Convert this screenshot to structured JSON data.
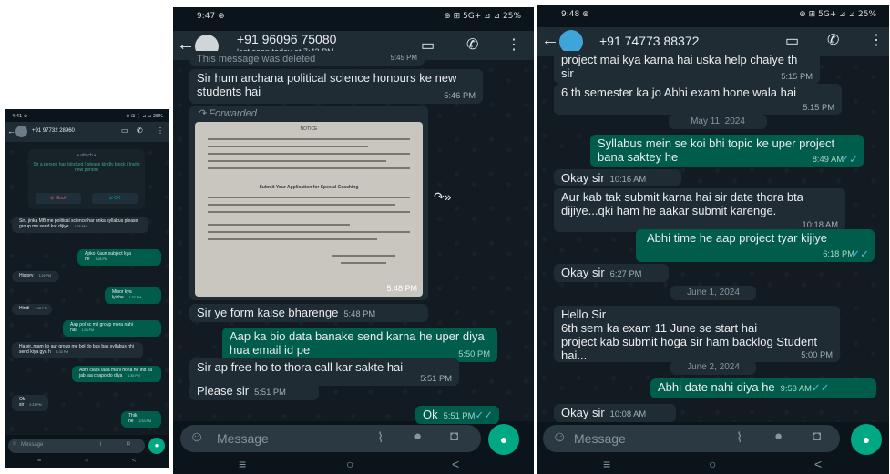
{
  "panel_left": {
    "status_time": "4:41 ⊕",
    "status_icons": "⊕ ⊞ ⋮ ⊿ ⊿ 28%",
    "contact": "+91 97732 28960",
    "system_note_1": "• attach •",
    "system_note_2": "Sir a person has blocked / please kindly block / Invite new person",
    "block_label": "⊘ Block",
    "ok_label": "⊘ OK",
    "messages": [
      {
        "dir": "in",
        "text": "Sir.. jinka MB me political science har unka syllabus please group me send kar dijiye",
        "time": "1:28 PM"
      },
      {
        "dir": "out",
        "text": "Apko Kaun subject kya he",
        "time": "1:28 PM"
      },
      {
        "dir": "in",
        "text": "History",
        "time": "1:29 PM"
      },
      {
        "dir": "out",
        "text": "Minor kya lyiche",
        "time": "1:32 PM"
      },
      {
        "dir": "in",
        "text": "Hindi",
        "time": "1:32 PM"
      },
      {
        "dir": "out",
        "text": "Aap pol sc mil group mera nahi hai",
        "time": "1:33 PM"
      },
      {
        "dir": "in",
        "text": "Ha sir..mam ko aur group me bol do bas bas syllabus nhi send kiya gya h",
        "time": "1:33 PM"
      },
      {
        "dir": "out",
        "text": "Abhi class laaa mahi hona he ind ka jab laa chapo do diya",
        "time": "1:35 PM"
      },
      {
        "dir": "in",
        "text": "Ok sir",
        "time": "2:33 PM"
      },
      {
        "dir": "out",
        "text": "Thik he",
        "time": "2:33 PM"
      }
    ],
    "input_placeholder": "Message"
  },
  "panel_middle": {
    "status_time": "9:47 ⊕",
    "status_icons": "⊕ ⊞ 5G+ ⊿ ⊿ 25%",
    "contact": "+91 96096 75080",
    "last_seen": "last seen today at 7:43 PM",
    "top_cut_message": "This message was deleted",
    "top_cut_time": "5:45 PM",
    "forward_icon_label": "↷»",
    "messages": [
      {
        "dir": "in",
        "text": "Sir hum archana political science honours ke new students hai",
        "time": "5:46 PM"
      },
      {
        "dir": "in",
        "text": "Sir ye form kaise bharenge",
        "time": "5:48 PM"
      },
      {
        "dir": "out",
        "text": "Aap ka bio data banake send karna he uper diya hua email id pe",
        "time": "5:50 PM"
      },
      {
        "dir": "in",
        "text": "Sir ap free ho to thora call kar sakte hai",
        "time": "5:51 PM"
      },
      {
        "dir": "in",
        "text": "Please sir",
        "time": "5:51 PM"
      },
      {
        "dir": "out",
        "text": "Ok",
        "time": "5:51 PM"
      }
    ],
    "forwarded_label": "Forwarded",
    "doc_title": "NOTICE",
    "doc_heading": "Submit Your Application for Special Coaching",
    "photo_time": "5:48 PM",
    "input_placeholder": "Message"
  },
  "panel_right": {
    "status_time": "9:48 ⊕",
    "status_icons": "⊕ ⊞ 5G+ ⊿ ⊿ 25%",
    "contact": "+91 74773 88372",
    "messages": [
      {
        "dir": "in",
        "text": "project mai kya  karna hai uska help chaiye th sir",
        "time": "5:15 PM"
      },
      {
        "dir": "in",
        "text": "6 th semester ka jo Abhi exam hone wala hai",
        "time": "5:15 PM"
      },
      {
        "dir": "out",
        "text": "Syllabus mein se koi bhi topic ke uper project bana saktey he",
        "time": "8:49 AM"
      },
      {
        "dir": "in",
        "text": "Okay sir",
        "time": "10:16 AM"
      },
      {
        "dir": "in",
        "text": "Aur kab tak submit karna hai sir date thora bta dijiye...qki ham he aakar submit karenge.",
        "time": "10:18 AM"
      },
      {
        "dir": "out",
        "text": "Abhi time he aap project tyar kijiye",
        "time": "6:18 PM"
      },
      {
        "dir": "in",
        "text": "Okay sir",
        "time": "6:27 PM"
      },
      {
        "dir": "in",
        "text": "Hello Sir\n6th sem ka exam 11 June se start hai\nproject kab submit hoga sir ham backlog Student hai...",
        "time": "5:00 PM"
      },
      {
        "dir": "out",
        "text": "Abhi date nahi diya he",
        "time": "9:53 AM"
      },
      {
        "dir": "in",
        "text": "Okay sir",
        "time": "10:08 AM"
      }
    ],
    "dates": [
      "May 11, 2024",
      "June 1, 2024",
      "June 2, 2024"
    ],
    "input_placeholder": "Message"
  },
  "nav": {
    "menu": "≡",
    "home": "○",
    "back": "<"
  },
  "colors": {
    "incoming": "#202c33",
    "outgoing": "#005c4b",
    "accent": "#00a884",
    "tick": "#53bdeb"
  }
}
